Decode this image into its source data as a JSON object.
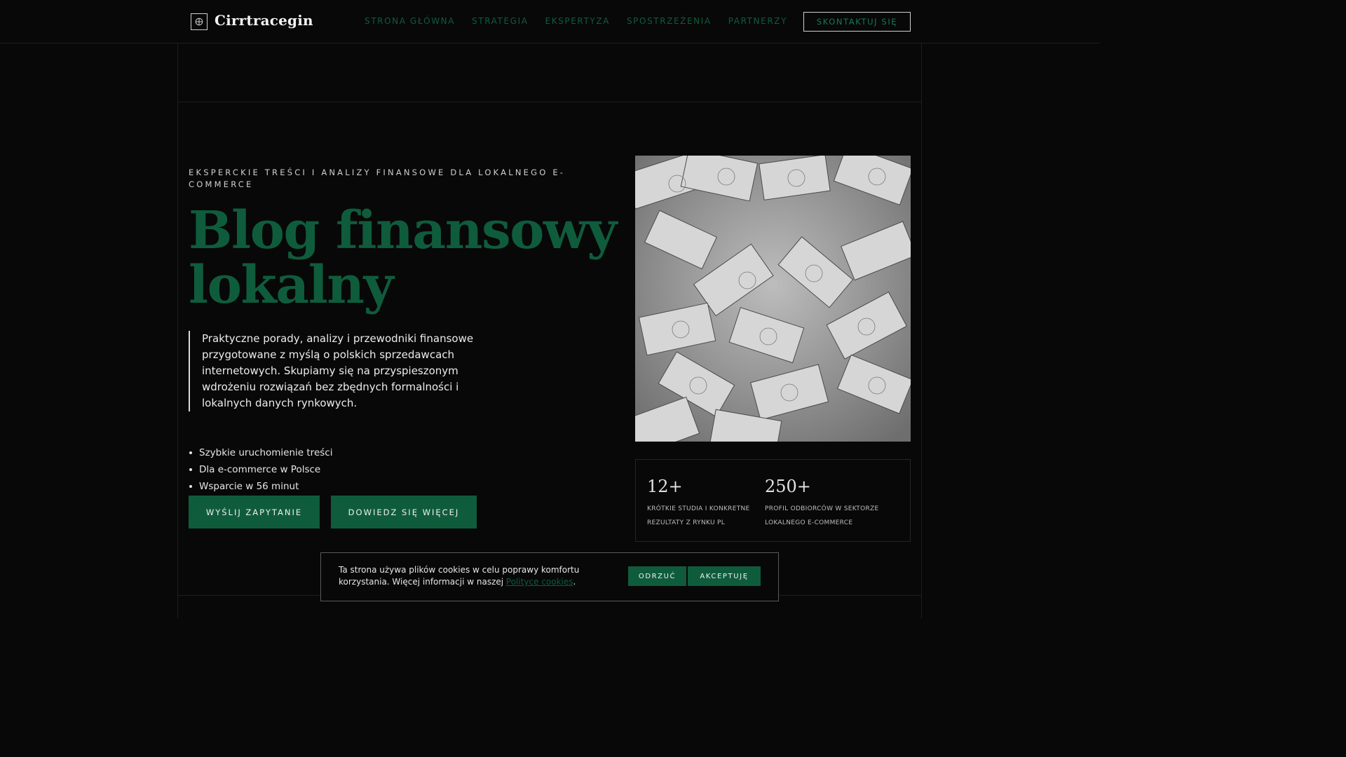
{
  "header": {
    "brand": "Cirrtracegin",
    "nav": [
      "STRONA GŁÓWNA",
      "STRATEGIA",
      "EKSPERTYZA",
      "SPOSTRZEŻENIA",
      "PARTNERZY"
    ],
    "cta": "SKONTAKTUJ SIĘ",
    "logo_icon": "globe-icon"
  },
  "hero": {
    "eyebrow": "EKSPERCKIE TREŚCI I ANALIZY FINANSOWE DLA LOKALNEGO E-COMMERCE",
    "title": "Blog finansowy lokalny",
    "lead": "Praktyczne porady, analizy i przewodniki finansowe przygotowane z myślą o polskich sprzedawcach internetowych. Skupiamy się na przyspieszonym wdrożeniu rozwiązań bez zbędnych formalności i lokalnych danych rynkowych.",
    "features": [
      "Szybkie uruchomienie treści",
      "Dla e-commerce w Polsce",
      "Wsparcie w 56 minut"
    ],
    "primary_button": "WYŚLIJ ZAPYTANIE",
    "secondary_button": "DOWIEDZ SIĘ WIĘCEJ",
    "image_note": "euro-banknotes-image"
  },
  "stats": [
    {
      "value": "12+",
      "label": "KRÓTKIE STUDIA I KONKRETNE REZULTATY Z RYNKU PL"
    },
    {
      "value": "250+",
      "label": "PROFIL ODBIORCÓW W SEKTORZE LOKALNEGO E-COMMERCE"
    }
  ],
  "cookie": {
    "text_before": "Ta strona używa plików cookies w celu poprawy komfortu korzystania. Więcej informacji w naszej ",
    "link": "Polityce cookies",
    "text_after": ".",
    "reject": "ODRZUĆ",
    "accept": "AKCEPTUJĘ"
  },
  "colors": {
    "background": "#080808",
    "accent": "#0f5c3d",
    "text": "#e6e6e6"
  }
}
